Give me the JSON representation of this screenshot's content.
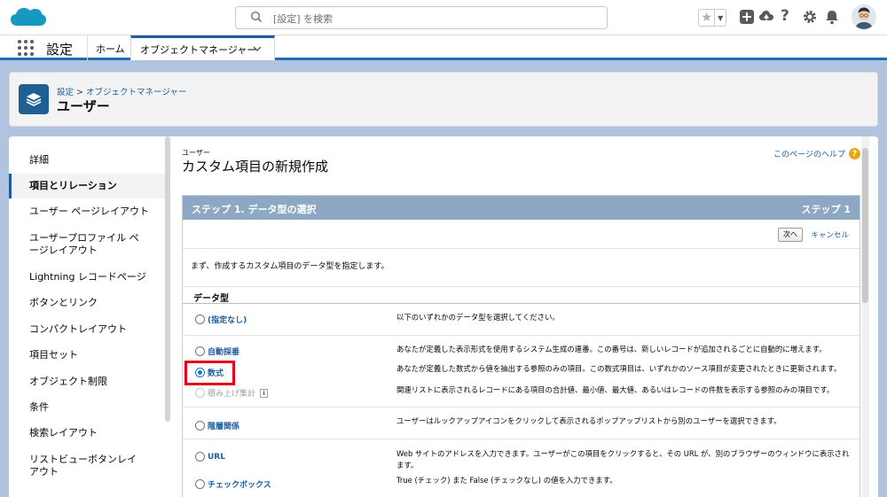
{
  "header": {
    "search_placeholder": "[設定] を検索"
  },
  "nav": {
    "app_name": "設定",
    "home": "ホーム",
    "tab": "オブジェクトマネージャー"
  },
  "object": {
    "breadcrumb_1": "設定",
    "breadcrumb_sep": ">",
    "breadcrumb_2": "オブジェクトマネージャー",
    "title": "ユーザー"
  },
  "sidebar": {
    "items": [
      {
        "label": "詳細"
      },
      {
        "label": "項目とリレーション",
        "active": true
      },
      {
        "label": "ユーザー ページレイアウト"
      },
      {
        "label": "ユーザープロファイル ページレイアウト"
      },
      {
        "label": "Lightning レコードページ"
      },
      {
        "label": "ボタンとリンク"
      },
      {
        "label": "コンパクトレイアウト"
      },
      {
        "label": "項目セット"
      },
      {
        "label": "オブジェクト制限"
      },
      {
        "label": "条件"
      },
      {
        "label": "検索レイアウト"
      },
      {
        "label": "リストビューボタンレイアウト"
      }
    ]
  },
  "main": {
    "object_label": "ユーザー",
    "page_title": "カスタム項目の新規作成",
    "help_link": "このページのヘルプ",
    "step_title": "ステップ 1. データ型の選択",
    "step_number": "ステップ 1",
    "next_button": "次へ",
    "cancel_link": "キャンセル",
    "intro": "まず、作成するカスタム項目のデータ型を指定します。",
    "section_title": "データ型",
    "options": [
      {
        "label": "(指定なし)",
        "desc": "以下のいずれかのデータ型を選択してください。",
        "selected": false,
        "disabled": false
      },
      {
        "label": "自動採番",
        "desc": "あなたが定義した表示形式を使用するシステム生成の連番。この番号は、新しいレコードが追加されるごとに自動的に増えます。",
        "selected": false,
        "disabled": false
      },
      {
        "label": "数式",
        "desc": "あなたが定義した数式から値を抽出する参照のみの項目。この数式項目は、いずれかのソース項目が変更されたときに更新されます。",
        "selected": true,
        "disabled": false
      },
      {
        "label": "積み上げ集計",
        "desc": "関連リストに表示されるレコードにある項目の合計値、最小値、最大値、あるいはレコードの件数を表示する参照のみの項目です。",
        "selected": false,
        "disabled": true,
        "info": "i"
      },
      {
        "label": "階層関係",
        "desc": "ユーザーはルックアップアイコンをクリックして表示されるポップアップリストから別のユーザーを選択できます。",
        "selected": false,
        "disabled": false
      },
      {
        "label": "URL",
        "desc": "Web サイトのアドレスを入力できます。ユーザーがこの項目をクリックすると、その URL が、別のブラウザーのウィンドウに表示されます。",
        "selected": false,
        "disabled": false
      },
      {
        "label": "チェックボックス",
        "desc": "True (チェック) また False (チェックなし) の値を入力できます。",
        "selected": false,
        "disabled": false
      }
    ]
  },
  "colors": {
    "brand": "#1b5ea3",
    "highlight": "#e4001a",
    "step_header": "#8ea8c4"
  }
}
